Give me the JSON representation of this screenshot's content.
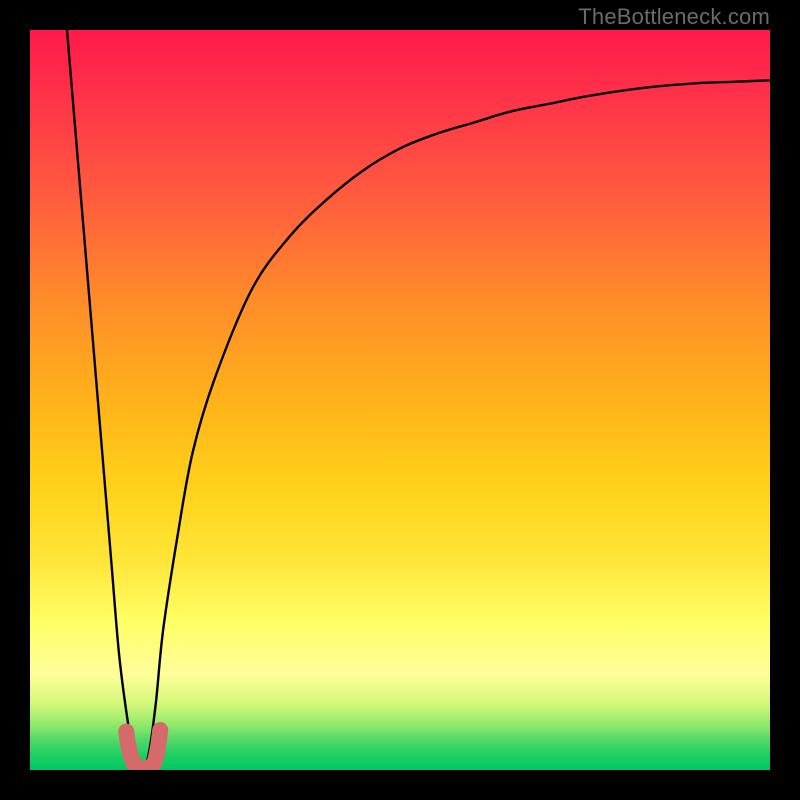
{
  "watermark": "TheBottleneck.com",
  "colors": {
    "background": "#000000",
    "curve": "#000000",
    "marker_fill": "#d46a6a",
    "marker_stroke": "#b84f4f"
  },
  "chart_data": {
    "type": "line",
    "title": "",
    "xlabel": "",
    "ylabel": "",
    "xlim": [
      0,
      100
    ],
    "ylim": [
      0,
      100
    ],
    "series": [
      {
        "name": "bottleneck-curve",
        "x": [
          5,
          6,
          7,
          8,
          9,
          10,
          11,
          12,
          13,
          14,
          15,
          16,
          17,
          18,
          20,
          22,
          25,
          30,
          35,
          40,
          45,
          50,
          55,
          60,
          65,
          70,
          75,
          80,
          85,
          90,
          95,
          100
        ],
        "y": [
          100,
          88,
          76,
          64,
          52,
          40,
          28,
          16,
          8,
          2,
          0,
          2,
          9,
          19,
          32,
          43,
          53,
          65,
          72,
          77,
          81,
          84,
          86,
          87.5,
          89,
          90,
          91,
          91.8,
          92.4,
          92.8,
          93,
          93.2
        ]
      }
    ],
    "markers": {
      "name": "short-red-path",
      "points": [
        {
          "x": 13.0,
          "y": 5.2
        },
        {
          "x": 13.4,
          "y": 2.8
        },
        {
          "x": 14.2,
          "y": 0.6
        },
        {
          "x": 15.4,
          "y": 0.3
        },
        {
          "x": 16.6,
          "y": 0.7
        },
        {
          "x": 17.2,
          "y": 2.6
        },
        {
          "x": 17.6,
          "y": 5.4
        }
      ],
      "stroke_width": 16
    }
  }
}
